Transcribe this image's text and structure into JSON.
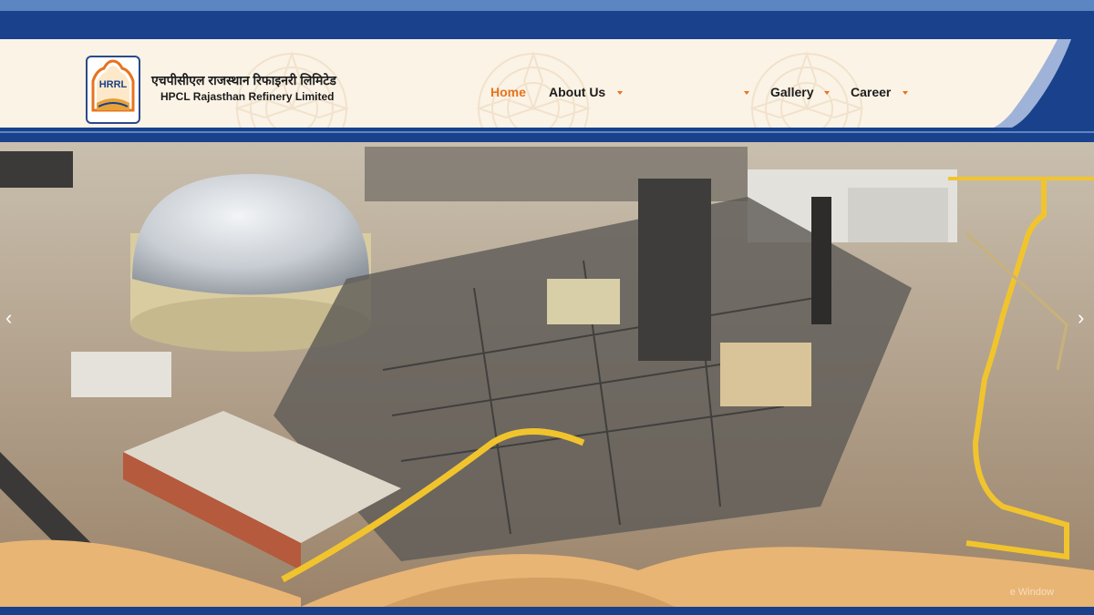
{
  "brand": {
    "logo_text": "HRRL",
    "name_hindi": "एचपीसीएल राजस्थान रिफाइनरी लिमिटेड",
    "name_english": "HPCL Rajasthan Refinery Limited"
  },
  "nav": {
    "items": [
      {
        "label": "Home",
        "active": true
      },
      {
        "label": "About Us",
        "active": false
      },
      {
        "label": "Gallery",
        "active": false
      },
      {
        "label": "Career",
        "active": false
      }
    ]
  },
  "hero": {
    "prev_icon": "chevron-left-icon",
    "next_icon": "chevron-right-icon",
    "prev_glyph": "‹",
    "next_glyph": "›"
  },
  "watermark": "e Window",
  "colors": {
    "primary_blue": "#1a418c",
    "accent_orange": "#e8731c",
    "header_bg": "#fbf3e6",
    "sand": "#e9b574"
  }
}
